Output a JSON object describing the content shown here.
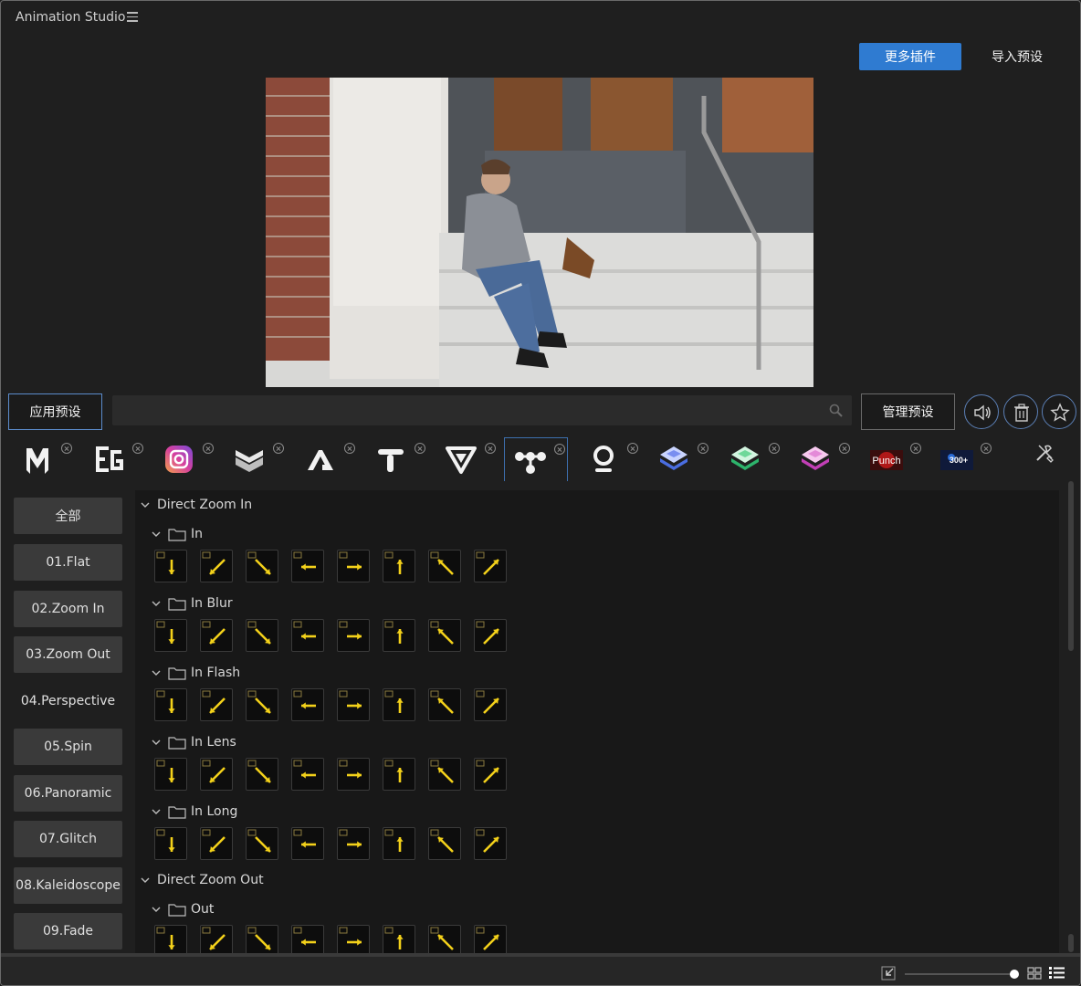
{
  "app": {
    "title": "Animation Studio"
  },
  "header": {
    "more_plugins_label": "更多插件",
    "import_presets_label": "导入预设"
  },
  "toolbar": {
    "apply_preset_label": "应用预设",
    "manage_presets_label": "管理预设",
    "search": {
      "value": "",
      "placeholder": ""
    }
  },
  "plugins": [
    {
      "icon": "m-logo-icon"
    },
    {
      "icon": "eg-logo-icon"
    },
    {
      "icon": "instagram-icon"
    },
    {
      "icon": "chevron-badge-icon"
    },
    {
      "icon": "a-logo-icon"
    },
    {
      "icon": "t-logo-icon"
    },
    {
      "icon": "v-logo-icon"
    },
    {
      "icon": "dots-logo-icon",
      "active": true
    },
    {
      "icon": "o-logo-icon"
    },
    {
      "icon": "blue-layers-icon"
    },
    {
      "icon": "green-layers-icon"
    },
    {
      "icon": "pink-layers-icon"
    },
    {
      "icon": "punch-logo-icon",
      "text": "Punch"
    },
    {
      "icon": "transitions-logo-icon",
      "text": "300+"
    }
  ],
  "sidebar": {
    "items": [
      {
        "label": "全部"
      },
      {
        "label": "01.Flat"
      },
      {
        "label": "02.Zoom In"
      },
      {
        "label": "03.Zoom Out"
      },
      {
        "label": "04.Perspective",
        "selected": true
      },
      {
        "label": "05.Spin"
      },
      {
        "label": "06.Panoramic"
      },
      {
        "label": "07.Glitch"
      },
      {
        "label": "08.Kaleidoscope"
      },
      {
        "label": "09.Fade"
      }
    ]
  },
  "tree": {
    "sections": [
      {
        "title": "Direct Zoom In",
        "folders": [
          {
            "name": "In"
          },
          {
            "name": "In Blur"
          },
          {
            "name": "In Flash"
          },
          {
            "name": "In Lens"
          },
          {
            "name": "In Long"
          }
        ]
      },
      {
        "title": "Direct Zoom Out",
        "folders": [
          {
            "name": "Out"
          }
        ]
      }
    ],
    "thumb_arrows": [
      "down",
      "down-left",
      "down-right",
      "left",
      "right",
      "up",
      "up-left",
      "up-right"
    ]
  },
  "footer": {
    "zoom_slider_value": 0.97
  },
  "colors": {
    "accent": "#2f7bd1",
    "arrow": "#f3d11a",
    "panel": "#181818"
  }
}
